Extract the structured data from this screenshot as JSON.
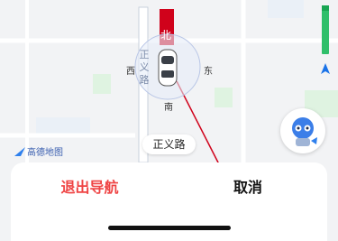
{
  "map": {
    "road_name_vertical": [
      "正",
      "义",
      "路"
    ],
    "road_label": "正义路",
    "compass": {
      "west": "西",
      "east": "东",
      "south": "南",
      "north": "北"
    },
    "logo_text": "高德地图"
  },
  "sheet": {
    "exit_label": "退出导航",
    "cancel_label": "取消"
  },
  "colors": {
    "exit": "#ef4444",
    "route_red": "#d0021b",
    "traffic_green": "#2fbf6a",
    "nav_blue": "#1a73e8"
  }
}
